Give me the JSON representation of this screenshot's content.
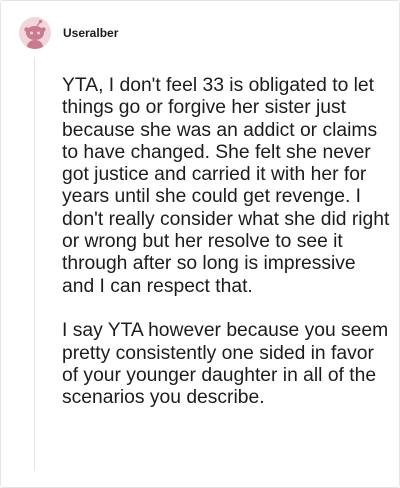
{
  "comment": {
    "username": "Useralber",
    "avatar_icon": "reddit-snoo-avatar",
    "avatar_bg": "#f1d6dc",
    "paragraphs": [
      "YTA, I don't feel 33 is obligated to let things go or forgive her sister just because she was an addict or claims to have changed. She felt she never got justice and carried it with her for years until she could get revenge. I don't really consider what she did right or wrong but her resolve to see it through after so long is impressive and I can respect that.",
      "I say YTA however because you seem pretty consistently one sided in favor of your younger daughter in all of the scenarios you describe."
    ]
  }
}
